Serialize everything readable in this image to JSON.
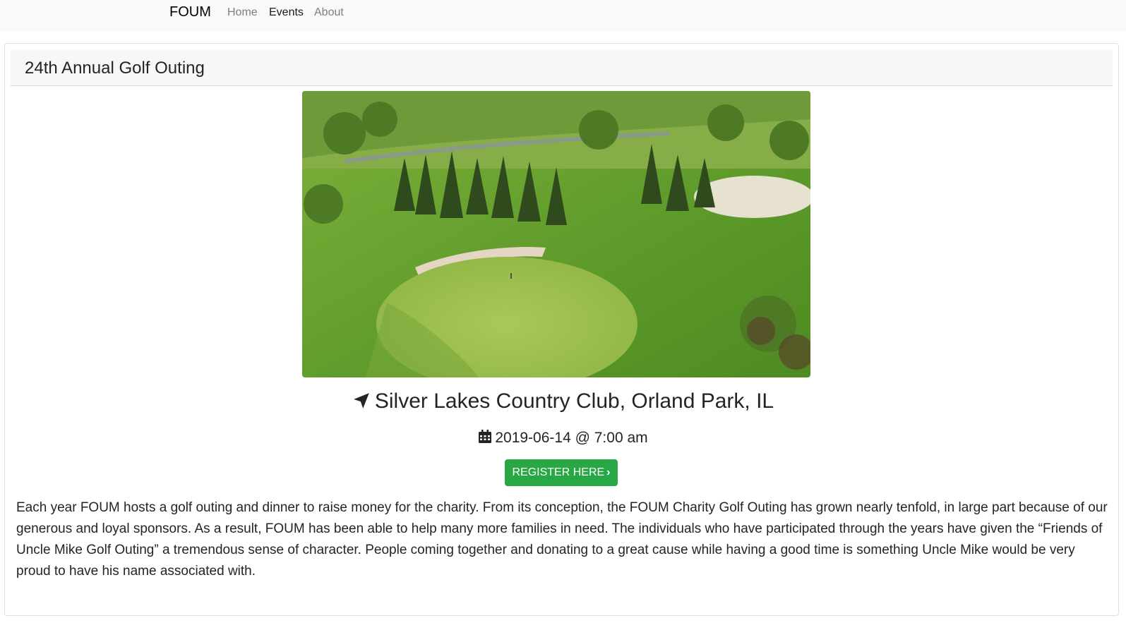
{
  "nav": {
    "brand": "FOUM",
    "links": [
      {
        "label": "Home",
        "active": false
      },
      {
        "label": "Events",
        "active": true
      },
      {
        "label": "About",
        "active": false
      }
    ]
  },
  "event": {
    "title": "24th Annual Golf Outing",
    "location": "Silver Lakes Country Club, Orland Park, IL",
    "location_icon": "location-arrow-icon",
    "datetime": "2019-06-14 @ 7:00 am",
    "date_icon": "calendar-icon",
    "register_label": "REGISTER HERE",
    "register_icon": "chevron-right-icon",
    "description": "Each year FOUM hosts a golf outing and dinner to raise money for the charity. From its conception, the FOUM Charity Golf Outing has grown nearly tenfold, in large part because of our generous and loyal sponsors. As a result, FOUM has been able to help many more families in need. The individuals who have participated through the years have given the “Friends of Uncle Mike Golf Outing” a tremendous sense of character. People coming together and donating to a great cause while having a good time is something Uncle Mike would be very proud to have his name associated with."
  },
  "colors": {
    "navbar_bg": "#f8f9fa",
    "button_green": "#28a745",
    "text": "#212529"
  }
}
